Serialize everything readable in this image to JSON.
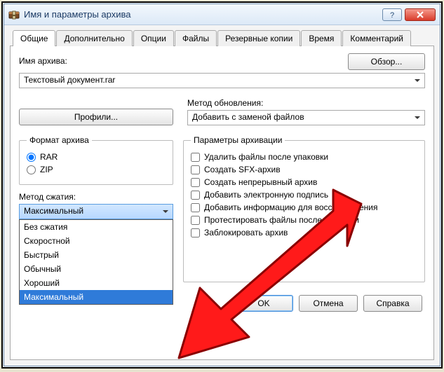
{
  "window": {
    "title": "Имя и параметры архива"
  },
  "tabs": [
    "Общие",
    "Дополнительно",
    "Опции",
    "Файлы",
    "Резервные копии",
    "Время",
    "Комментарий"
  ],
  "archive_name": {
    "label": "Имя архива:",
    "value": "Текстовый документ.rar",
    "browse": "Обзор..."
  },
  "profiles_btn": "Профили...",
  "update_method": {
    "label": "Метод обновления:",
    "value": "Добавить с заменой файлов"
  },
  "format": {
    "legend": "Формат архива",
    "options": [
      "RAR",
      "ZIP"
    ],
    "selected": "RAR"
  },
  "compression": {
    "label": "Метод сжатия:",
    "value": "Максимальный",
    "options": [
      "Без сжатия",
      "Скоростной",
      "Быстрый",
      "Обычный",
      "Хороший",
      "Максимальный"
    ]
  },
  "params": {
    "legend": "Параметры архивации",
    "items": [
      "Удалить файлы после упаковки",
      "Создать SFX-архив",
      "Создать непрерывный архив",
      "Добавить электронную подпись",
      "Добавить информацию для восстановления",
      "Протестировать файлы после упаковки",
      "Заблокировать архив"
    ]
  },
  "buttons": {
    "ok": "OK",
    "cancel": "Отмена",
    "help": "Справка"
  }
}
